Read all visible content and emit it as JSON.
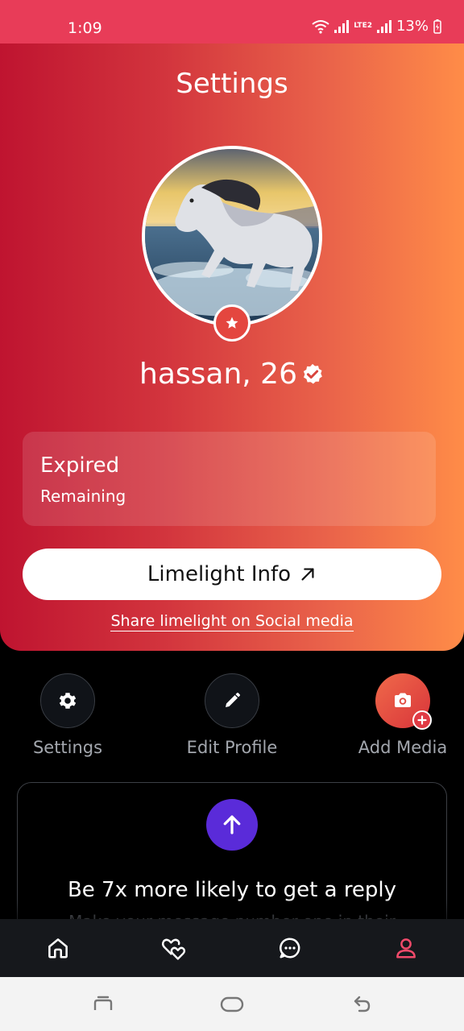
{
  "status_bar": {
    "time": "1:09",
    "network": "LTE2",
    "battery": "13%"
  },
  "header": {
    "title": "Settings"
  },
  "profile": {
    "name": "hassan, 26",
    "verified_icon": "verified-badge-icon",
    "avatar_icon": "profile-photo-horse",
    "badge_icon": "star-icon"
  },
  "subscription": {
    "status": "Expired",
    "remaining_label": "Remaining"
  },
  "limelight": {
    "button_label": "Limelight Info",
    "button_icon": "arrow-up-right-icon",
    "share_link": "Share limelight on Social media"
  },
  "actions": [
    {
      "label": "Settings",
      "icon": "gear-icon"
    },
    {
      "label": "Edit Profile",
      "icon": "pencil-icon"
    },
    {
      "label": "Add Media",
      "icon": "camera-icon"
    }
  ],
  "boost": {
    "icon": "arrow-up-icon",
    "title": "Be 7x more likely to get a reply",
    "subtitle": "Make your message number one in their"
  },
  "bottom_nav": [
    {
      "name": "home",
      "icon": "home-icon"
    },
    {
      "name": "matches",
      "icon": "hearts-icon"
    },
    {
      "name": "messages",
      "icon": "chat-icon"
    },
    {
      "name": "profile",
      "icon": "user-icon",
      "active": true
    }
  ],
  "system_nav": [
    "recents-icon",
    "home-pill-icon",
    "back-icon"
  ],
  "colors": {
    "status_bar": "#e83c58",
    "gradient_start": "#bf1430",
    "gradient_end": "#ff8c48",
    "boost_purple": "#5a2bd9",
    "active_nav": "#f04a6a"
  }
}
